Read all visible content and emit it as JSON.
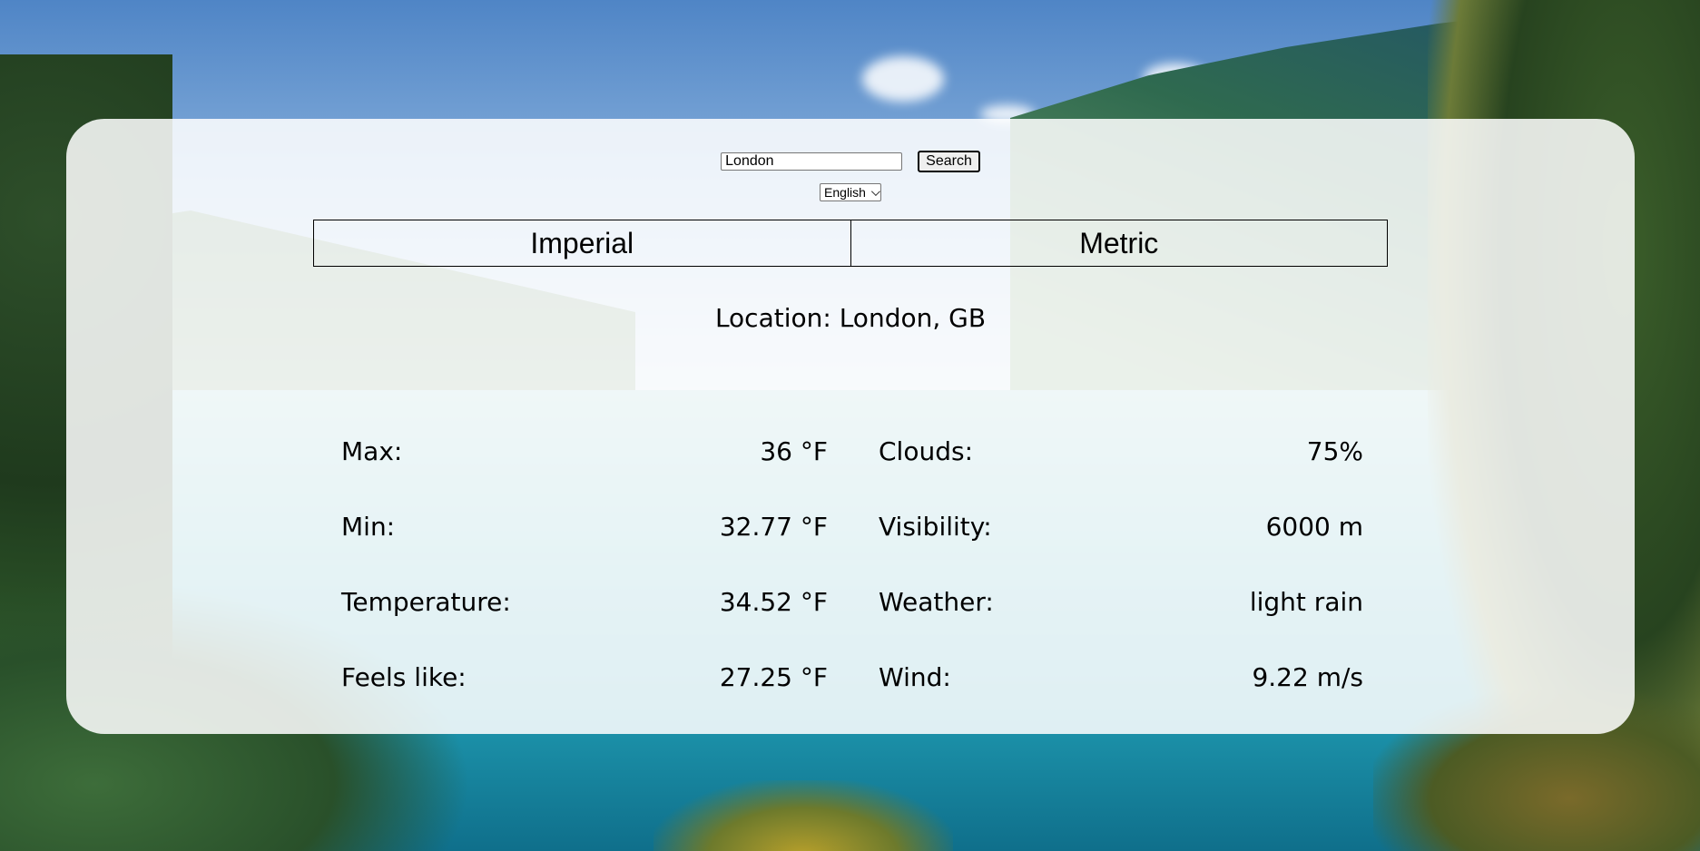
{
  "search": {
    "value": "London",
    "button_label": "Search"
  },
  "language": {
    "selected": "English"
  },
  "units": {
    "imperial_label": "Imperial",
    "metric_label": "Metric"
  },
  "location": {
    "label": "Location:",
    "value": "London, GB"
  },
  "weather": {
    "left": [
      {
        "label": "Max:",
        "value": "36 °F"
      },
      {
        "label": "Min:",
        "value": "32.77 °F"
      },
      {
        "label": "Temperature:",
        "value": "34.52 °F"
      },
      {
        "label": "Feels like:",
        "value": "27.25 °F"
      }
    ],
    "right": [
      {
        "label": "Clouds:",
        "value": "75%"
      },
      {
        "label": "Visibility:",
        "value": "6000 m"
      },
      {
        "label": "Weather:",
        "value": "light rain"
      },
      {
        "label": "Wind:",
        "value": "9.22 m/s"
      }
    ]
  }
}
